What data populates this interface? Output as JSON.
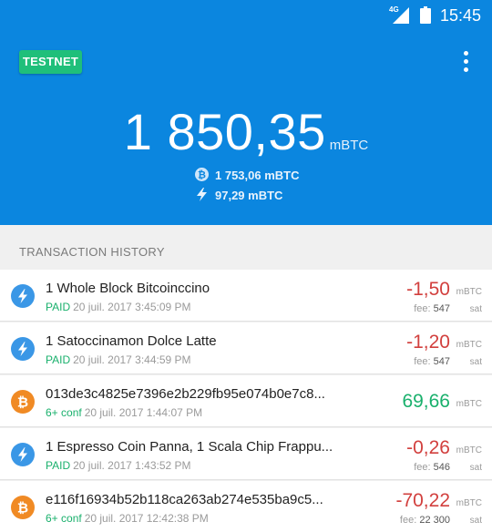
{
  "status_bar": {
    "network": "4G",
    "time": "15:45"
  },
  "header": {
    "badge": "TESTNET",
    "balance_amount": "1 850,35",
    "balance_unit": "mBTC",
    "onchain_balance": "1 753,06 mBTC",
    "lightning_balance": "97,29 mBTC"
  },
  "history": {
    "title": "TRANSACTION HISTORY",
    "items": [
      {
        "type": "lightning",
        "title": "1 Whole Block Bitcoinccino",
        "status": "PAID",
        "date": "20 juil. 2017 3:45:09 PM",
        "amount": "-1,50",
        "unit": "mBTC",
        "fee_label": "fee:",
        "fee": "547",
        "fee_unit": "sat",
        "direction": "out"
      },
      {
        "type": "lightning",
        "title": "1 Satoccinamon Dolce Latte",
        "status": "PAID",
        "date": "20 juil. 2017 3:44:59 PM",
        "amount": "-1,20",
        "unit": "mBTC",
        "fee_label": "fee:",
        "fee": "547",
        "fee_unit": "sat",
        "direction": "out"
      },
      {
        "type": "bitcoin",
        "title": "013de3c4825e7396e2b229fb95e074b0e7c8...",
        "status": "6+ conf",
        "date": "20 juil. 2017 1:44:07 PM",
        "amount": "69,66",
        "unit": "mBTC",
        "fee_label": "",
        "fee": "",
        "fee_unit": "",
        "direction": "in"
      },
      {
        "type": "lightning",
        "title": "1 Espresso Coin Panna, 1 Scala Chip Frappu...",
        "status": "PAID",
        "date": "20 juil. 2017 1:43:52 PM",
        "amount": "-0,26",
        "unit": "mBTC",
        "fee_label": "fee:",
        "fee": "546",
        "fee_unit": "sat",
        "direction": "out"
      },
      {
        "type": "bitcoin",
        "title": "e116f16934b52b118ca263ab274e535ba9c5...",
        "status": "6+ conf",
        "date": "20 juil. 2017 12:42:38 PM",
        "amount": "-70,22",
        "unit": "mBTC",
        "fee_label": "fee:",
        "fee": "22 300",
        "fee_unit": "sat",
        "direction": "out"
      }
    ]
  },
  "colors": {
    "header_bg": "#0b86df",
    "testnet_badge": "#1fbf7a",
    "negative": "#d2403e",
    "positive": "#19b06c",
    "lightning_icon": "#3a97e6",
    "bitcoin_icon": "#f08a24"
  },
  "icons": {
    "menu": "more-vert-icon",
    "lightning": "lightning-icon",
    "bitcoin": "bitcoin-icon"
  }
}
